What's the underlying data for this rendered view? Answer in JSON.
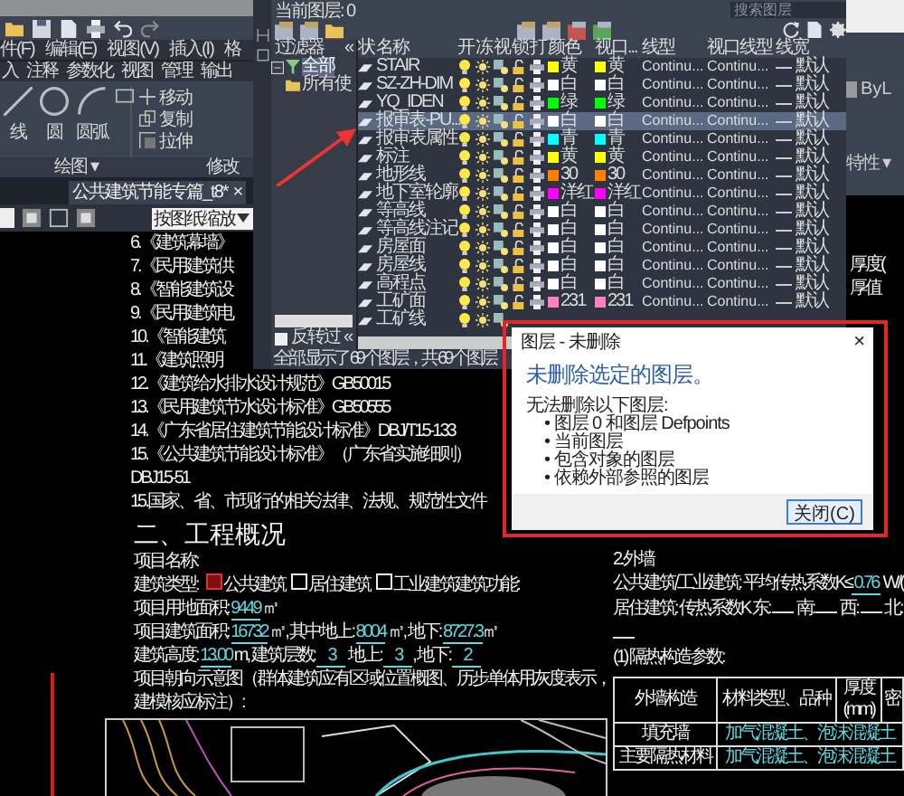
{
  "ribbon": {
    "menu": [
      "件(F)",
      "编辑(E)",
      "视图(V)",
      "插入(I)",
      "格"
    ],
    "tabs": [
      {
        "label": "入",
        "selected": false
      },
      {
        "label": "注释",
        "selected": false
      },
      {
        "label": "参数化",
        "selected": false
      },
      {
        "label": "视图",
        "selected": false
      },
      {
        "label": "管理",
        "selected": false
      },
      {
        "label": "输出",
        "selected": false
      }
    ],
    "draw_tools": [
      "线",
      "圆",
      "圆弧"
    ],
    "modify_tools": [
      "移动",
      "复制",
      "拉伸"
    ],
    "panel_labels": [
      "绘图 ▾",
      "修改"
    ],
    "doc_tab": {
      "title": "公共建筑节能专篇_t8*",
      "close": "×"
    },
    "scale_dropdown": "按图纸缩放"
  },
  "layer_manager": {
    "current_layer": "当前图层: 0",
    "search_placeholder": "搜索图层",
    "filters": {
      "title": "过滤器",
      "collapse": "«",
      "tree": [
        {
          "label": "全部",
          "selected": true,
          "expanded": true,
          "children": [
            {
              "label": "所有使",
              "selected": false
            }
          ]
        }
      ],
      "invert_label": "反转过",
      "invert_checked": false
    },
    "columns": [
      "状",
      "名称",
      "开",
      "冻",
      "视",
      "锁",
      "打",
      "颜色",
      "视口...",
      "线型",
      "视口线型",
      "线宽"
    ],
    "rows": [
      {
        "name": "STAIR",
        "on": true,
        "color": "#ffff00",
        "color_name": "黄",
        "vp_color_name": "黄",
        "linetype": "Continu...",
        "vp_linetype": "Continu...",
        "lineweight": "默认",
        "selected": false
      },
      {
        "name": "SZ-ZH-DIM",
        "on": true,
        "color": "#ffffff",
        "color_name": "白",
        "vp_color_name": "白",
        "linetype": "Continu...",
        "vp_linetype": "Continu...",
        "lineweight": "默认",
        "selected": false
      },
      {
        "name": "YQ_IDEN",
        "on": true,
        "color": "#00ff00",
        "color_name": "绿",
        "vp_color_name": "绿",
        "linetype": "Continu...",
        "vp_linetype": "Continu...",
        "lineweight": "默认",
        "selected": false
      },
      {
        "name": "报审表-PU...",
        "on": true,
        "color": "#ffffff",
        "color_name": "白",
        "vp_color_name": "白",
        "linetype": "Continu...",
        "vp_linetype": "Continu...",
        "lineweight": "默认",
        "selected": true
      },
      {
        "name": "报审表属性",
        "on": true,
        "color": "#00ffff",
        "color_name": "青",
        "vp_color_name": "青",
        "linetype": "Continu...",
        "vp_linetype": "Continu...",
        "lineweight": "默认",
        "selected": false
      },
      {
        "name": "标注",
        "on": true,
        "color": "#ffff00",
        "color_name": "黄",
        "vp_color_name": "黄",
        "linetype": "Continu...",
        "vp_linetype": "Continu...",
        "lineweight": "默认",
        "selected": false
      },
      {
        "name": "地形线",
        "on": true,
        "color": "#ff7f00",
        "color_name": "30",
        "vp_color_name": "30",
        "linetype": "Continu...",
        "vp_linetype": "Continu...",
        "lineweight": "默认",
        "selected": false
      },
      {
        "name": "地下室轮廓",
        "on": true,
        "color": "#ff00ff",
        "color_name": "洋红",
        "vp_color_name": "洋红",
        "linetype": "Continu...",
        "vp_linetype": "Continu...",
        "lineweight": "默认",
        "selected": false
      },
      {
        "name": "等高线",
        "on": true,
        "color": "#ffffff",
        "color_name": "白",
        "vp_color_name": "白",
        "linetype": "Continu...",
        "vp_linetype": "Continu...",
        "lineweight": "默认",
        "selected": false
      },
      {
        "name": "等高线注记",
        "on": true,
        "color": "#ffffff",
        "color_name": "白",
        "vp_color_name": "白",
        "linetype": "Continu...",
        "vp_linetype": "Continu...",
        "lineweight": "默认",
        "selected": false
      },
      {
        "name": "房屋面",
        "on": true,
        "color": "#ffffff",
        "color_name": "白",
        "vp_color_name": "白",
        "linetype": "Continu...",
        "vp_linetype": "Continu...",
        "lineweight": "默认",
        "selected": false
      },
      {
        "name": "房屋线",
        "on": true,
        "color": "#ffffff",
        "color_name": "白",
        "vp_color_name": "白",
        "linetype": "Continu...",
        "vp_linetype": "Continu...",
        "lineweight": "默认",
        "selected": false
      },
      {
        "name": "高程点",
        "on": true,
        "color": "#ffffff",
        "color_name": "白",
        "vp_color_name": "白",
        "linetype": "Continu...",
        "vp_linetype": "Continu...",
        "lineweight": "默认",
        "selected": false
      },
      {
        "name": "工矿面",
        "on": true,
        "color": "#ff7fbf",
        "color_name": "231",
        "vp_color_name": "231",
        "linetype": "Continu...",
        "vp_linetype": "Continu...",
        "lineweight": "默认",
        "selected": false
      },
      {
        "name": "工矿线",
        "on": true,
        "selected": false
      }
    ],
    "status": "全部: 显示了 69 个图层，共 69 个图层"
  },
  "properties_panel": {
    "linetype_value": "ByL",
    "section": "特性 ▾"
  },
  "dialog": {
    "title": "图层 - 未删除",
    "close": "×",
    "heading": "未删除选定的图层。",
    "intro": "无法删除以下图层:",
    "bullets": [
      "• 图层 0 和图层 Defpoints",
      "• 当前图层",
      "• 包含对象的图层",
      "• 依赖外部参照的图层"
    ],
    "button": "关闭(C)"
  },
  "drawing": {
    "standards": [
      "6.《建筑幕墙》",
      "7.《民用建筑供",
      "8.《智能建筑设",
      "9.《民用建筑电",
      "10.《智能建筑",
      "11.《建筑照明",
      "12.《建筑给水排水设计规范》GB50015",
      "13.《民用建筑节水设计标准》GB50555",
      "14.《广东省居住建筑节能设计标准》DBJ/T15-133",
      "15.《公共建筑节能设计标准》（广东省实施细则）DBJ15-51",
      "15.国家、省、市现行的相关法律、法规、规范性文件"
    ],
    "section_title": "二、工程概况",
    "overview": [
      [
        {
          "kind": "text",
          "text": "项目名称:"
        }
      ],
      [
        {
          "kind": "text",
          "text": "建筑类型: "
        },
        {
          "kind": "check",
          "checked": true,
          "text": "公共建筑"
        },
        {
          "kind": "check",
          "checked": false,
          "text": "居住建筑"
        },
        {
          "kind": "check",
          "checked": false,
          "text": "工业建筑"
        },
        {
          "kind": "text",
          "text": "建筑功能:"
        }
      ],
      [
        {
          "kind": "text",
          "text": "项目用地面积: "
        },
        {
          "kind": "value",
          "text": "9449"
        },
        {
          "kind": "text",
          "text": " ㎡"
        }
      ],
      [
        {
          "kind": "text",
          "text": "项目建筑面积: "
        },
        {
          "kind": "value",
          "text": "16732"
        },
        {
          "kind": "text",
          "text": " ㎡, 其中地上: "
        },
        {
          "kind": "value",
          "text": "8004"
        },
        {
          "kind": "text",
          "text": " ㎡, 地下: "
        },
        {
          "kind": "value",
          "text": "8727.3"
        },
        {
          "kind": "text",
          "text": "㎡"
        }
      ],
      [
        {
          "kind": "text",
          "text": "建筑高度: "
        },
        {
          "kind": "value",
          "text": "13.00"
        },
        {
          "kind": "text",
          "text": " m, 建筑层数: "
        },
        {
          "kind": "value",
          "text": "3"
        },
        {
          "kind": "text",
          "text": " 地上: "
        },
        {
          "kind": "value",
          "text": "3"
        },
        {
          "kind": "text",
          "text": ", 地下: "
        },
        {
          "kind": "value",
          "text": "2"
        }
      ],
      [
        {
          "kind": "text",
          "text": "项目朝向示意图（群体建筑应有区域位置概图、历步单体用灰度表示，建模核应标注）:"
        }
      ]
    ],
    "exterior_wall": {
      "title": "2.外墙",
      "lines": [
        [
          {
            "kind": "text",
            "text": "公共建筑/工业建筑: 平均传热系数K≤"
          },
          {
            "kind": "value",
            "text": "0.76"
          },
          {
            "kind": "text",
            "text": " W/("
          }
        ],
        [
          {
            "kind": "text",
            "text": "居住建筑: 传热系数K 东: "
          },
          {
            "kind": "blank"
          },
          {
            "kind": "text",
            "text": " 南: "
          },
          {
            "kind": "blank"
          },
          {
            "kind": "text",
            "text": " 西: "
          },
          {
            "kind": "blank"
          },
          {
            "kind": "text",
            "text": " 北: "
          },
          {
            "kind": "blank"
          }
        ],
        [
          {
            "kind": "text",
            "text": "(1) 隔热构造参数:"
          }
        ]
      ],
      "table": {
        "columns": [
          "外墙构造",
          "材料类型、品种",
          "厚度(mm)",
          "密"
        ],
        "rows": [
          {
            "label": "填充墙",
            "material": "加气混凝土、泡沫混凝土"
          },
          {
            "label": "主要隔热材料",
            "material": "加气混凝土、泡沫混凝土"
          }
        ]
      }
    },
    "side_labels": [
      "厚度(",
      "厚值"
    ]
  }
}
